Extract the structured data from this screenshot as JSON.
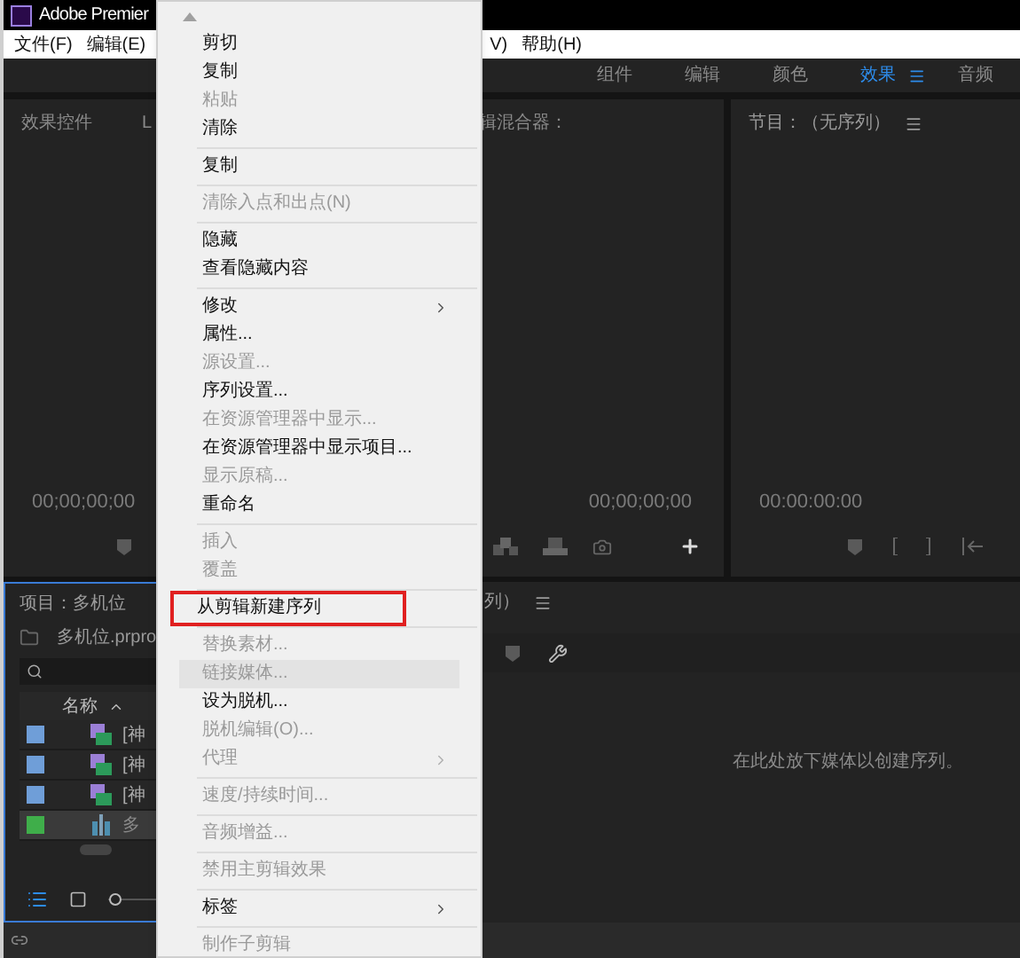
{
  "window": {
    "title": "Adobe Premier"
  },
  "menubar": [
    {
      "label": "文件(F)"
    },
    {
      "label": "编辑(E)"
    },
    {
      "label": "V)"
    },
    {
      "label": "帮助(H)"
    }
  ],
  "workspaces": [
    {
      "label": "组件",
      "selected": false
    },
    {
      "label": "编辑",
      "selected": false
    },
    {
      "label": "颜色",
      "selected": false
    },
    {
      "label": "效果",
      "selected": true
    },
    {
      "label": "音频",
      "selected": false
    }
  ],
  "source_panel": {
    "tabs": [
      "效果控件",
      "L"
    ],
    "timecode": "00;00;00;00"
  },
  "mixer_panel": {
    "title": "辑混合器：",
    "timecode": "00;00;00;00"
  },
  "program_panel": {
    "title": "节目：（无序列）",
    "timecode": "00:00:00:00"
  },
  "project_panel": {
    "title": "项目：多机位",
    "file": "多机位.prpro",
    "column": "名称",
    "zoom_slider": {
      "level": 0
    },
    "rows": [
      {
        "name": "[神",
        "kind": "clip",
        "color": "#6f9ed8",
        "selected": false
      },
      {
        "name": "[神",
        "kind": "clip",
        "color": "#6f9ed8",
        "selected": false
      },
      {
        "name": "[神",
        "kind": "clip",
        "color": "#6f9ed8",
        "selected": false
      },
      {
        "name": "多",
        "kind": "multicam",
        "color": "#3fae4a",
        "selected": true
      }
    ]
  },
  "timeline_panel": {
    "title": "列）",
    "message": "在此处放下媒体以创建序列。"
  },
  "context_menu": [
    {
      "kind": "scroll-arrow"
    },
    {
      "kind": "item",
      "label": "剪切",
      "disabled": false,
      "selected": false,
      "outlined": false,
      "submenu": false
    },
    {
      "kind": "item",
      "label": "复制",
      "disabled": false,
      "selected": false,
      "outlined": false,
      "submenu": false
    },
    {
      "kind": "item",
      "label": "粘贴",
      "disabled": true,
      "selected": false,
      "outlined": false,
      "submenu": false
    },
    {
      "kind": "item",
      "label": "清除",
      "disabled": false,
      "selected": false,
      "outlined": false,
      "submenu": false
    },
    {
      "kind": "separator"
    },
    {
      "kind": "item",
      "label": "复制",
      "disabled": false,
      "selected": false,
      "outlined": false,
      "submenu": false
    },
    {
      "kind": "separator"
    },
    {
      "kind": "item",
      "label": "清除入点和出点(N)",
      "disabled": true,
      "selected": false,
      "outlined": false,
      "submenu": false
    },
    {
      "kind": "separator"
    },
    {
      "kind": "item",
      "label": "隐藏",
      "disabled": false,
      "selected": false,
      "outlined": false,
      "submenu": false
    },
    {
      "kind": "item",
      "label": "查看隐藏内容",
      "disabled": false,
      "selected": false,
      "outlined": false,
      "submenu": false
    },
    {
      "kind": "separator"
    },
    {
      "kind": "item",
      "label": "修改",
      "disabled": false,
      "selected": false,
      "outlined": false,
      "submenu": true
    },
    {
      "kind": "item",
      "label": "属性...",
      "disabled": false,
      "selected": false,
      "outlined": false,
      "submenu": false
    },
    {
      "kind": "item",
      "label": "源设置...",
      "disabled": true,
      "selected": false,
      "outlined": false,
      "submenu": false
    },
    {
      "kind": "item",
      "label": "序列设置...",
      "disabled": false,
      "selected": false,
      "outlined": false,
      "submenu": false
    },
    {
      "kind": "item",
      "label": "在资源管理器中显示...",
      "disabled": true,
      "selected": false,
      "outlined": false,
      "submenu": false
    },
    {
      "kind": "item",
      "label": "在资源管理器中显示项目...",
      "disabled": false,
      "selected": false,
      "outlined": false,
      "submenu": false
    },
    {
      "kind": "item",
      "label": "显示原稿...",
      "disabled": true,
      "selected": false,
      "outlined": false,
      "submenu": false
    },
    {
      "kind": "item",
      "label": "重命名",
      "disabled": false,
      "selected": false,
      "outlined": false,
      "submenu": false
    },
    {
      "kind": "separator"
    },
    {
      "kind": "item",
      "label": "插入",
      "disabled": true,
      "selected": false,
      "outlined": false,
      "submenu": false
    },
    {
      "kind": "item",
      "label": "覆盖",
      "disabled": true,
      "selected": false,
      "outlined": false,
      "submenu": false
    },
    {
      "kind": "separator"
    },
    {
      "kind": "item",
      "label": "从剪辑新建序列",
      "disabled": false,
      "selected": false,
      "outlined": true,
      "submenu": false
    },
    {
      "kind": "separator"
    },
    {
      "kind": "item",
      "label": "替换素材...",
      "disabled": true,
      "selected": false,
      "outlined": false,
      "submenu": false
    },
    {
      "kind": "item",
      "label": "链接媒体...",
      "disabled": true,
      "selected": true,
      "outlined": false,
      "submenu": false
    },
    {
      "kind": "item",
      "label": "设为脱机...",
      "disabled": false,
      "selected": false,
      "outlined": false,
      "submenu": false
    },
    {
      "kind": "item",
      "label": "脱机编辑(O)...",
      "disabled": true,
      "selected": false,
      "outlined": false,
      "submenu": false
    },
    {
      "kind": "item",
      "label": "代理",
      "disabled": true,
      "selected": false,
      "outlined": false,
      "submenu": true
    },
    {
      "kind": "separator"
    },
    {
      "kind": "item",
      "label": "速度/持续时间...",
      "disabled": true,
      "selected": false,
      "outlined": false,
      "submenu": false
    },
    {
      "kind": "separator"
    },
    {
      "kind": "item",
      "label": "音频增益...",
      "disabled": true,
      "selected": false,
      "outlined": false,
      "submenu": false
    },
    {
      "kind": "separator"
    },
    {
      "kind": "item",
      "label": "禁用主剪辑效果",
      "disabled": true,
      "selected": false,
      "outlined": false,
      "submenu": false
    },
    {
      "kind": "separator"
    },
    {
      "kind": "item",
      "label": "标签",
      "disabled": false,
      "selected": false,
      "outlined": false,
      "submenu": true
    },
    {
      "kind": "separator"
    },
    {
      "kind": "item",
      "label": "制作子剪辑",
      "disabled": true,
      "selected": false,
      "outlined": false,
      "submenu": false
    }
  ]
}
